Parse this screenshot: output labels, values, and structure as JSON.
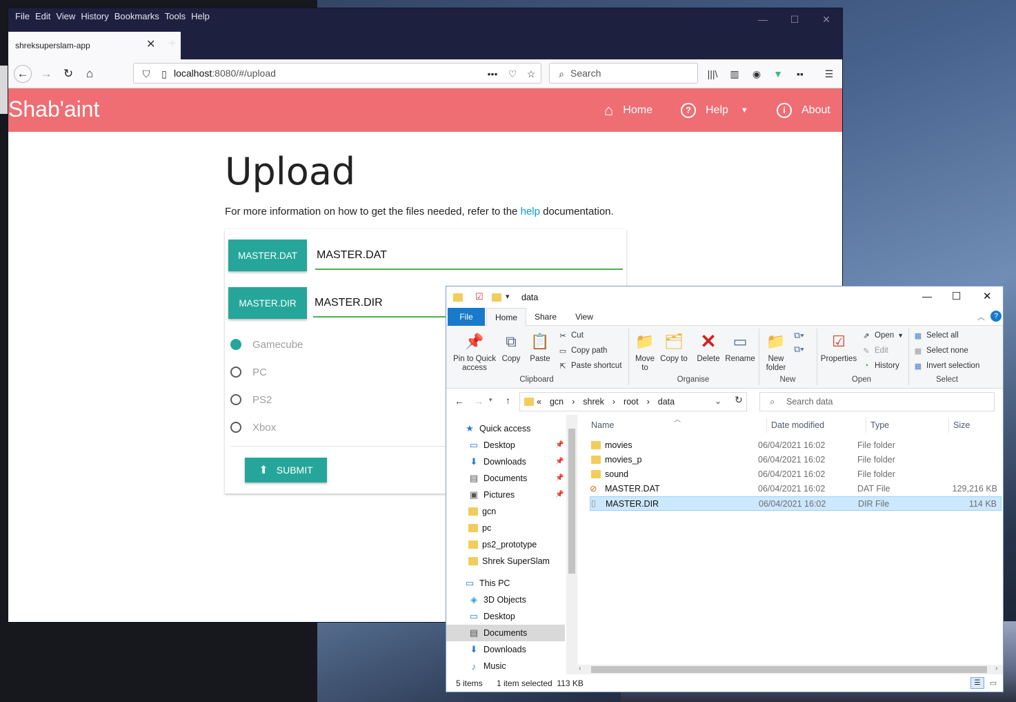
{
  "firefox": {
    "menu": [
      "File",
      "Edit",
      "View",
      "History",
      "Bookmarks",
      "Tools",
      "Help"
    ],
    "tab_title": "shreksuperslam-app",
    "url_host": "localhost",
    "url_rest": ":8080/#/upload",
    "search_placeholder": "Search",
    "window_controls": {
      "min": "—",
      "max": "☐",
      "close": "✕"
    }
  },
  "app": {
    "brand": "Shab'aint",
    "nav": {
      "home": "Home",
      "help": "Help",
      "about": "About"
    },
    "accent_color": "#ee6e73",
    "button_color": "#26a69a"
  },
  "upload": {
    "title": "Upload",
    "info_before": "For more information on how to get the files needed, refer to the ",
    "info_link": "help",
    "info_after": " documentation.",
    "files": [
      {
        "button": "MASTER.DAT",
        "value": "MASTER.DAT"
      },
      {
        "button": "MASTER.DIR",
        "value": "MASTER.DIR"
      }
    ],
    "platforms": [
      "Gamecube",
      "PC",
      "PS2",
      "Xbox"
    ],
    "selected_platform": "Gamecube",
    "submit": "SUBMIT"
  },
  "explorer": {
    "title": "data",
    "tabs": [
      "File",
      "Home",
      "Share",
      "View"
    ],
    "ribbon": {
      "clipboard": {
        "label": "Clipboard",
        "pin": "Pin to Quick access",
        "copy": "Copy",
        "paste": "Paste",
        "cut": "Cut",
        "copy_path": "Copy path",
        "paste_shortcut": "Paste shortcut"
      },
      "organise": {
        "label": "Organise",
        "move_to": "Move to",
        "copy_to": "Copy to",
        "delete": "Delete",
        "rename": "Rename"
      },
      "new": {
        "label": "New",
        "new_folder": "New folder"
      },
      "open": {
        "label": "Open",
        "properties": "Properties",
        "open": "Open",
        "edit": "Edit",
        "history": "History"
      },
      "select": {
        "label": "Select",
        "select_all": "Select all",
        "select_none": "Select none",
        "invert": "Invert selection"
      }
    },
    "breadcrumb": [
      "gcn",
      "shrek",
      "root",
      "data"
    ],
    "search_placeholder": "Search data",
    "nav": [
      {
        "label": "Quick access",
        "icon": "star-icon",
        "pinned": false,
        "indent": 0
      },
      {
        "label": "Desktop",
        "icon": "desktop-icon",
        "pinned": true,
        "indent": 1
      },
      {
        "label": "Downloads",
        "icon": "download-icon",
        "pinned": true,
        "indent": 1
      },
      {
        "label": "Documents",
        "icon": "documents-icon",
        "pinned": true,
        "indent": 1
      },
      {
        "label": "Pictures",
        "icon": "pictures-icon",
        "pinned": true,
        "indent": 1
      },
      {
        "label": "gcn",
        "icon": "folder-icon",
        "pinned": false,
        "indent": 1
      },
      {
        "label": "pc",
        "icon": "folder-icon",
        "pinned": false,
        "indent": 1
      },
      {
        "label": "ps2_prototype",
        "icon": "folder-icon",
        "pinned": false,
        "indent": 1
      },
      {
        "label": "Shrek SuperSlam",
        "icon": "folder-icon",
        "pinned": false,
        "indent": 1
      },
      {
        "label": "This PC",
        "icon": "computer-icon",
        "pinned": false,
        "indent": 0
      },
      {
        "label": "3D Objects",
        "icon": "cube-icon",
        "pinned": false,
        "indent": 1
      },
      {
        "label": "Desktop",
        "icon": "desktop-icon",
        "pinned": false,
        "indent": 1
      },
      {
        "label": "Documents",
        "icon": "documents-icon",
        "pinned": false,
        "indent": 1
      },
      {
        "label": "Downloads",
        "icon": "download-icon",
        "pinned": false,
        "indent": 1
      },
      {
        "label": "Music",
        "icon": "music-icon",
        "pinned": false,
        "indent": 1
      }
    ],
    "selected_nav": "Documents",
    "columns": {
      "name": "Name",
      "date": "Date modified",
      "type": "Type",
      "size": "Size"
    },
    "files": [
      {
        "name": "movies",
        "date": "06/04/2021 16:02",
        "type": "File folder",
        "size": "",
        "icon": "folder-icon"
      },
      {
        "name": "movies_p",
        "date": "06/04/2021 16:02",
        "type": "File folder",
        "size": "",
        "icon": "folder-icon"
      },
      {
        "name": "sound",
        "date": "06/04/2021 16:02",
        "type": "File folder",
        "size": "",
        "icon": "folder-icon"
      },
      {
        "name": "MASTER.DAT",
        "date": "06/04/2021 16:02",
        "type": "DAT File",
        "size": "129,216 KB",
        "icon": "dat-file-icon"
      },
      {
        "name": "MASTER.DIR",
        "date": "06/04/2021 16:02",
        "type": "DIR File",
        "size": "114 KB",
        "icon": "file-icon"
      }
    ],
    "selected_file": "MASTER.DIR",
    "status": {
      "items": "5 items",
      "selection": "1 item selected  113 KB"
    }
  }
}
